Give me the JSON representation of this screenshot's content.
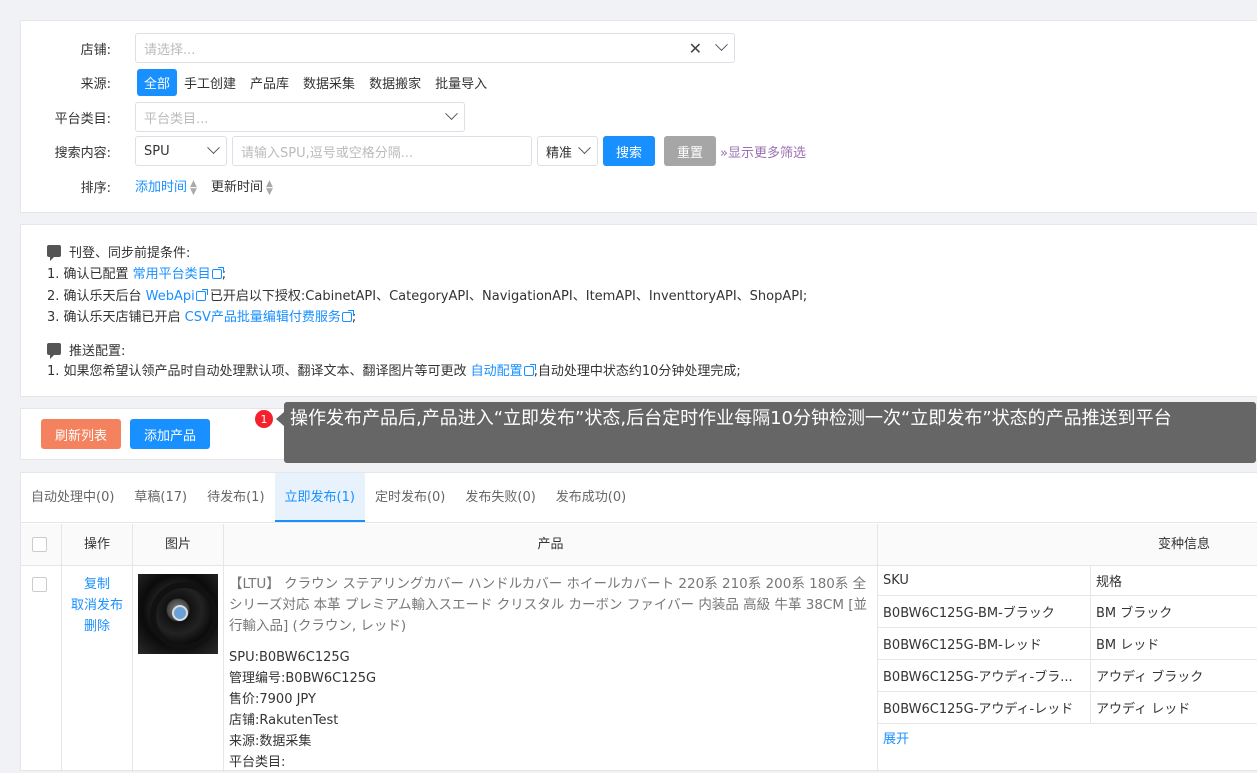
{
  "filter": {
    "shop_label": "店铺:",
    "shop_placeholder": "请选择...",
    "source_label": "来源:",
    "sources": [
      "全部",
      "手工创建",
      "产品库",
      "数据采集",
      "数据搬家",
      "批量导入"
    ],
    "platform_label": "平台类目:",
    "platform_placeholder": "平台类目...",
    "search_label": "搜索内容:",
    "search_field": "SPU",
    "search_placeholder": "请输入SPU,逗号或空格分隔...",
    "match_mode": "精准",
    "search_button": "搜索",
    "reset_button": "重置",
    "more_filters": "显示更多筛选",
    "sort_label": "排序:",
    "sort_added": "添加时间",
    "sort_updated": "更新时间"
  },
  "notice": {
    "prereq_title": "刊登、同步前提条件:",
    "line1_a": "1. 确认已配置 ",
    "line1_link": "常用平台类目",
    "line1_b": ";",
    "line2_a": "2. 确认乐天后台 ",
    "line2_link": "WebApi",
    "line2_b": " 已开启以下授权:CabinetAPI、CategoryAPI、NavigationAPI、ItemAPI、InventtoryAPI、ShopAPI;",
    "line3_a": "3. 确认乐天店铺已开启 ",
    "line3_link": "CSV产品批量编辑付费服务",
    "line3_b": ";",
    "push_title": "推送配置:",
    "push_a": "1. 如果您希望认领产品时自动处理默认项、翻译文本、翻译图片等可更改 ",
    "push_link": "自动配置",
    "push_b": ",自动处理中状态约10分钟处理完成;"
  },
  "actions": {
    "refresh": "刷新列表",
    "add": "添加产品"
  },
  "tooltip": {
    "badge": "1",
    "text": "操作发布产品后,产品进入“立即发布”状态,后台定时作业每隔10分钟检测一次“立即发布”状态的产品推送到平台"
  },
  "tabs": [
    "自动处理中(0)",
    "草稿(17)",
    "待发布(1)",
    "立即发布(1)",
    "定时发布(0)",
    "发布失败(0)",
    "发布成功(0)"
  ],
  "table": {
    "headers": {
      "op": "操作",
      "img": "图片",
      "product": "产品",
      "variant": "变种信息"
    },
    "ops": [
      "复制",
      "取消发布",
      "删除"
    ],
    "title": "【LTU】 クラウン ステアリングカバー ハンドルカバー ホイールカバート 220系 210系 200系 180系 全シリーズ対応 本革 プレミアム輸入スエード クリスタル カーボン ファイバー 内装品 高級 牛革 38CM [並行輸入品] (クラウン, レッド)",
    "spu": "SPU:B0BW6C125G",
    "code": "管理编号:B0BW6C125G",
    "price": "售价:7900 JPY",
    "shop": "店铺:RakutenTest",
    "source": "来源:数据采集",
    "category": "平台类目:",
    "sku_header": "SKU",
    "spec_header": "规格",
    "skus": [
      {
        "sku": "B0BW6C125G-BM-ブラック",
        "spec": "BM ブラック"
      },
      {
        "sku": "B0BW6C125G-BM-レッド",
        "spec": "BM レッド"
      },
      {
        "sku": "B0BW6C125G-アウディ-ブラ...",
        "spec": "アウディ ブラック"
      },
      {
        "sku": "B0BW6C125G-アウディ-レッド",
        "spec": "アウディ レッド"
      }
    ],
    "expand": "展开"
  },
  "colors": {
    "primary": "#1890ff",
    "refresh": "#f4825f",
    "reset": "#a6a6a6",
    "tooltip": "#666666",
    "badge": "#f5222d"
  }
}
